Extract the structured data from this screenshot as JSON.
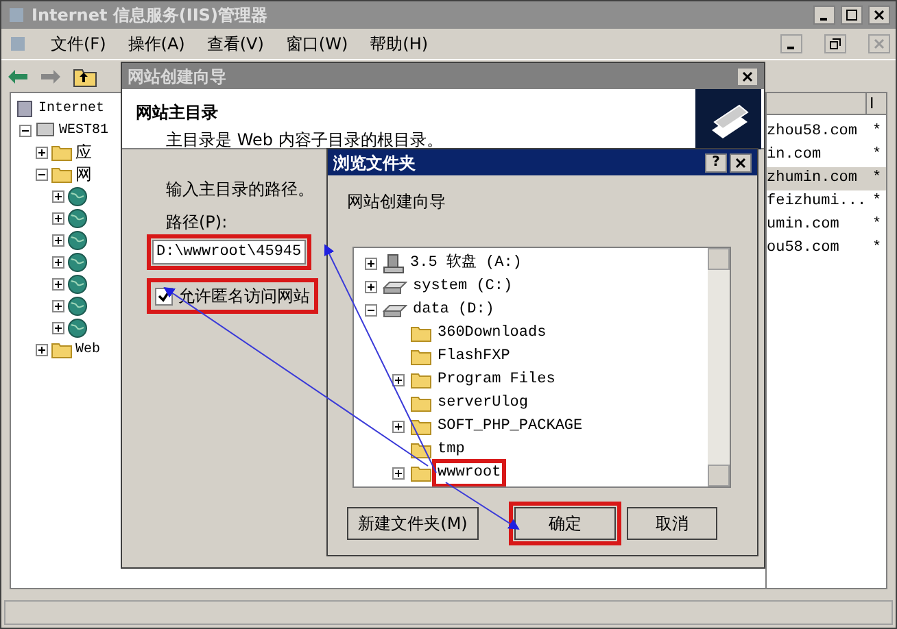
{
  "main_window": {
    "title": "Internet 信息服务(IIS)管理器",
    "menu": [
      "文件(F)",
      "操作(A)",
      "查看(V)",
      "窗口(W)",
      "帮助(H)"
    ],
    "tree": [
      {
        "label": "Internet",
        "children": [
          {
            "label": "WEST81",
            "expanded": true,
            "children": [
              {
                "label": "应",
                "expanded": false
              },
              {
                "label": "网",
                "expanded": true,
                "children": [
                  {
                    "expanded": false
                  },
                  {
                    "expanded": false
                  },
                  {
                    "expanded": false
                  },
                  {
                    "expanded": false
                  },
                  {
                    "expanded": false
                  },
                  {
                    "expanded": false
                  },
                  {
                    "expanded": false
                  }
                ]
              },
              {
                "label": "Web",
                "expanded": false
              }
            ]
          }
        ]
      }
    ],
    "list": {
      "column_2": "I",
      "rows": [
        {
          "name": "zhou58.com",
          "column_2": "*",
          "selected": false
        },
        {
          "name": "in.com",
          "column_2": "*",
          "selected": false
        },
        {
          "name": "zhumin.com",
          "column_2": "*",
          "selected": true
        },
        {
          "name": "feizhumi...",
          "column_2": "*",
          "selected": false
        },
        {
          "name": "umin.com",
          "column_2": "*",
          "selected": false
        },
        {
          "name": "ou58.com",
          "column_2": "*",
          "selected": false
        }
      ]
    }
  },
  "wizard": {
    "title": "网站创建向导",
    "heading": "网站主目录",
    "subtitle": "主目录是 Web 内容子目录的根目录。",
    "prompt": "输入主目录的路径。",
    "path_label": "路径(P):",
    "path_value": "D:\\wwwroot\\45945",
    "path_annotated": true,
    "checkbox": {
      "label": "允许匿名访问网站",
      "checked": true,
      "annotated": true
    }
  },
  "browse_dialog": {
    "title": "浏览文件夹",
    "help": "?",
    "description": "网站创建向导",
    "tree": [
      {
        "label": "3.5 软盘 (A:)",
        "kind": "floppy",
        "expanded": false,
        "annotated": false
      },
      {
        "label": "system (C:)",
        "kind": "drive",
        "expanded": false,
        "annotated": false
      },
      {
        "label": "data (D:)",
        "kind": "drive",
        "expanded": true,
        "annotated": false,
        "children": [
          {
            "label": "360Downloads",
            "kind": "folder",
            "annotated": false
          },
          {
            "label": "FlashFXP",
            "kind": "folder",
            "annotated": false
          },
          {
            "label": "Program Files",
            "kind": "folder",
            "expanded": false,
            "annotated": false
          },
          {
            "label": "serverUlog",
            "kind": "folder",
            "annotated": false
          },
          {
            "label": "SOFT_PHP_PACKAGE",
            "kind": "folder",
            "expanded": false,
            "annotated": false
          },
          {
            "label": "tmp",
            "kind": "folder",
            "annotated": false
          },
          {
            "label": "wwwroot",
            "kind": "folder",
            "expanded": false,
            "annotated": true
          }
        ]
      }
    ],
    "buttons": [
      {
        "label": "新建文件夹(M)",
        "annotated": false
      },
      {
        "label": "确定",
        "annotated": true
      },
      {
        "label": "取消",
        "annotated": false
      }
    ]
  }
}
